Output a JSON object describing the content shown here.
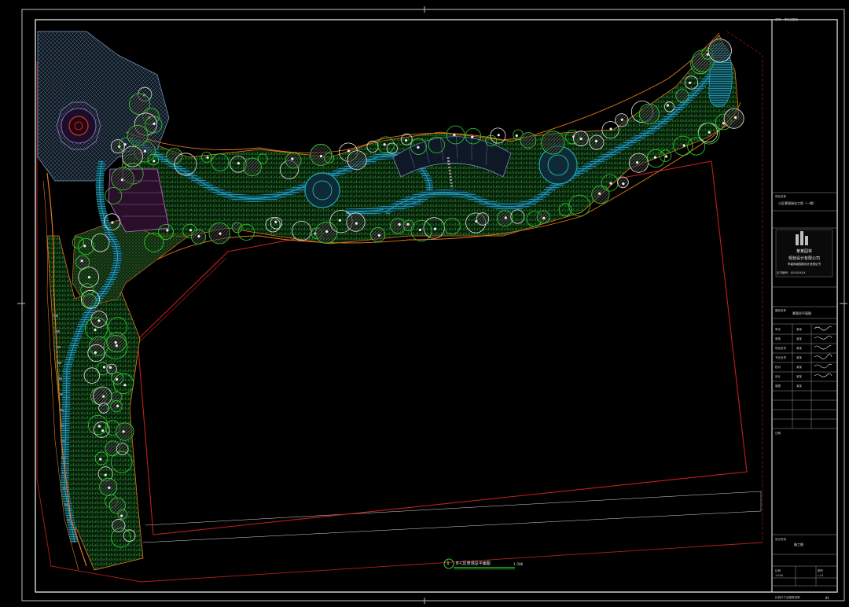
{
  "drawing": {
    "plan_title": "B-C区景观总平面图",
    "plan_number": "1",
    "scale": "1:500",
    "sheet_number": "01",
    "frame_note": "比例尺寸见图签说明"
  },
  "title_block": {
    "top_note": "说明：    单位见图纸",
    "project_label": "项目名称",
    "project_name": "小区景观绿化工程（一期）",
    "company_line1": "某某园林",
    "company_line2": "规划设计有限公司",
    "company_line3": "甲级风景园林设计资质证书",
    "cert_line": "证书编号：XXXXXXXX",
    "drawing_name_label": "图纸名称",
    "drawing_name": "景观总平面图",
    "rows": [
      {
        "role": "审定",
        "name": "某某"
      },
      {
        "role": "审核",
        "name": "某某"
      },
      {
        "role": "项目负责",
        "name": "某某"
      },
      {
        "role": "专业负责",
        "name": "某某"
      },
      {
        "role": "校对",
        "name": "某某"
      },
      {
        "role": "设计",
        "name": "某某"
      },
      {
        "role": "制图",
        "name": "某某"
      }
    ],
    "date_label": "日期",
    "stage_label": "设计阶段",
    "stage": "施工图",
    "scale_label": "比例",
    "scale": "1:500",
    "drawing_no_label": "图号",
    "drawing_no": "L-01"
  },
  "colors": {
    "background": "#000000",
    "frame": "#ffffff",
    "plant_fill": "#1e8a2e",
    "tree_circle": "#2fd42f",
    "path_edge": "#e07a1e",
    "water": "#1aa6b8",
    "boundary": "#c0201c",
    "hatch": "#c9b46a",
    "plaza": "#8e5bb5"
  }
}
